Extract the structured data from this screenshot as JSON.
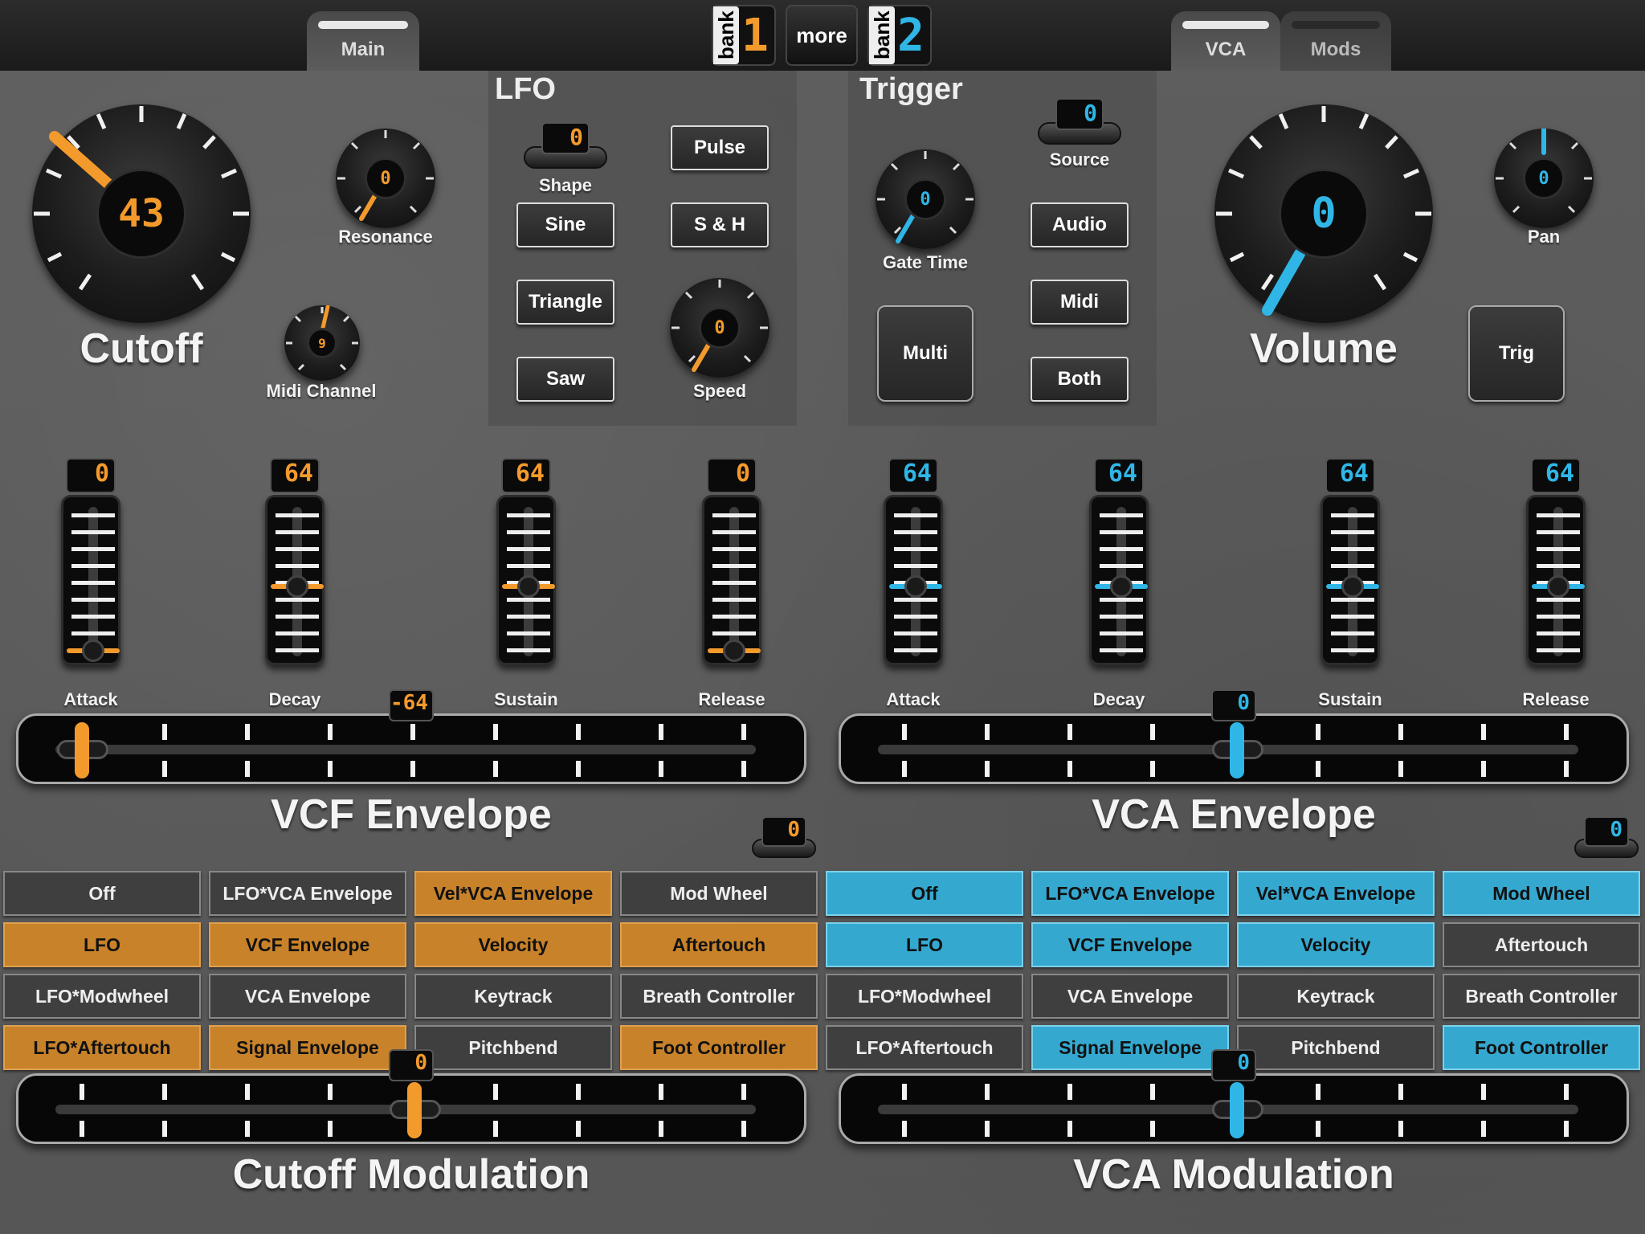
{
  "tabs": {
    "main": "Main",
    "vca": "VCA",
    "mods": "Mods"
  },
  "banks": {
    "bank1_word": "bank",
    "bank1_num": "1",
    "more": "more",
    "bank2_word": "bank",
    "bank2_num": "2"
  },
  "colors": {
    "orange": "#f39a2c",
    "blue": "#2fb6e6"
  },
  "cutoff": {
    "label": "Cutoff",
    "value": "43"
  },
  "resonance": {
    "label": "Resonance",
    "value": "0"
  },
  "midi_channel": {
    "label": "Midi Channel",
    "value": "9"
  },
  "lfo": {
    "title": "LFO",
    "shape_label": "Shape",
    "shape_value": "0",
    "buttons": [
      "Sine",
      "Triangle",
      "Saw",
      "Pulse",
      "S & H"
    ],
    "speed_label": "Speed",
    "speed_value": "0"
  },
  "trigger": {
    "title": "Trigger",
    "source_label": "Source",
    "source_value": "0",
    "gate_label": "Gate Time",
    "gate_value": "0",
    "multi": "Multi",
    "buttons": [
      "Audio",
      "Midi",
      "Both"
    ]
  },
  "volume": {
    "label": "Volume",
    "value": "0"
  },
  "pan": {
    "label": "Pan",
    "value": "0"
  },
  "trig": "Trig",
  "vcf_env": {
    "title": "VCF Envelope",
    "faders": [
      {
        "label": "Attack",
        "value": "0"
      },
      {
        "label": "Decay",
        "value": "64"
      },
      {
        "label": "Sustain",
        "value": "64"
      },
      {
        "label": "Release",
        "value": "0"
      }
    ],
    "amount": "-64"
  },
  "vca_env": {
    "title": "VCA Envelope",
    "faders": [
      {
        "label": "Attack",
        "value": "64"
      },
      {
        "label": "Decay",
        "value": "64"
      },
      {
        "label": "Sustain",
        "value": "64"
      },
      {
        "label": "Release",
        "value": "64"
      }
    ],
    "amount": "0"
  },
  "cutoff_mod": {
    "title": "Cutoff Modulation",
    "selector_value": "0",
    "amount": "0",
    "grid": [
      [
        "Off",
        "LFO*VCA Envelope",
        "Vel*VCA Envelope",
        "Mod Wheel"
      ],
      [
        "LFO",
        "VCF Envelope",
        "Velocity",
        "Aftertouch"
      ],
      [
        "LFO*Modwheel",
        "VCA Envelope",
        "Keytrack",
        "Breath Controller"
      ],
      [
        "LFO*Aftertouch",
        "Signal Envelope",
        "Pitchbend",
        "Foot Controller"
      ]
    ]
  },
  "vca_mod": {
    "title": "VCA Modulation",
    "selector_value": "0",
    "amount": "0",
    "grid": [
      [
        "Off",
        "LFO*VCA Envelope",
        "Vel*VCA Envelope",
        "Mod Wheel"
      ],
      [
        "LFO",
        "VCF Envelope",
        "Velocity",
        "Aftertouch"
      ],
      [
        "LFO*Modwheel",
        "VCA Envelope",
        "Keytrack",
        "Breath Controller"
      ],
      [
        "LFO*Aftertouch",
        "Signal Envelope",
        "Pitchbend",
        "Foot Controller"
      ]
    ]
  }
}
